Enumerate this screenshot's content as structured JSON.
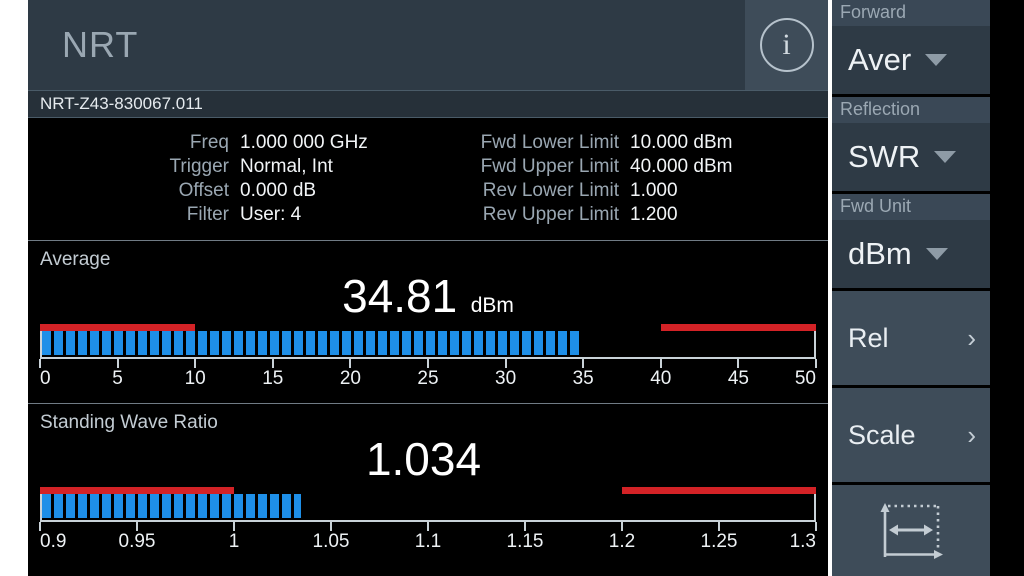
{
  "header": {
    "app_title": "NRT",
    "info_icon": "info-icon",
    "info_glyph": "i"
  },
  "device": {
    "id": "NRT-Z43-830067.011"
  },
  "parameters": {
    "left": [
      {
        "label": "Freq",
        "value": "1.000 000 GHz"
      },
      {
        "label": "Trigger",
        "value": "Normal, Int"
      },
      {
        "label": "Offset",
        "value": "0.000 dB"
      },
      {
        "label": "Filter",
        "value": "User: 4"
      }
    ],
    "right": [
      {
        "label": "Fwd Lower Limit",
        "value": "10.000 dBm"
      },
      {
        "label": "Fwd Upper Limit",
        "value": "40.000 dBm"
      },
      {
        "label": "Rev Lower Limit",
        "value": "1.000"
      },
      {
        "label": "Rev Upper Limit",
        "value": "1.200"
      }
    ]
  },
  "colors": {
    "bar_blue": "#1e8fe8",
    "limit_red": "#d32226",
    "panel_slate": "#2e3a45",
    "button_slate": "#3e4c59",
    "screen_black": "#000000"
  },
  "chart_data": [
    {
      "type": "bar",
      "title": "Average",
      "value": 34.81,
      "value_text": "34.81",
      "unit": "dBm",
      "xlim": [
        0,
        50
      ],
      "tick_labels": [
        "0",
        "5",
        "10",
        "15",
        "20",
        "25",
        "30",
        "35",
        "40",
        "45",
        "50"
      ],
      "ticks": [
        0,
        5,
        10,
        15,
        20,
        25,
        30,
        35,
        40,
        45,
        50
      ],
      "limit_zones": [
        {
          "name": "lower-limit-zone",
          "from": 0,
          "to": 10
        },
        {
          "name": "upper-limit-zone",
          "from": 40,
          "to": 50
        }
      ],
      "grid": false,
      "legend": "none"
    },
    {
      "type": "bar",
      "title": "Standing Wave Ratio",
      "value": 1.034,
      "value_text": "1.034",
      "unit": "",
      "xlim": [
        0.9,
        1.3
      ],
      "tick_labels": [
        "0.9",
        "0.95",
        "1",
        "1.05",
        "1.1",
        "1.15",
        "1.2",
        "1.25",
        "1.3"
      ],
      "ticks": [
        0.9,
        0.95,
        1,
        1.05,
        1.1,
        1.15,
        1.2,
        1.25,
        1.3
      ],
      "limit_zones": [
        {
          "name": "lower-limit-zone",
          "from": 0.9,
          "to": 1.0
        },
        {
          "name": "upper-limit-zone",
          "from": 1.2,
          "to": 1.3
        }
      ],
      "grid": false,
      "legend": "none"
    }
  ],
  "sidebar": {
    "dropdowns": [
      {
        "label": "Forward",
        "value": "Aver",
        "icon": "chevron-down-icon"
      },
      {
        "label": "Reflection",
        "value": "SWR",
        "icon": "chevron-down-icon"
      },
      {
        "label": "Fwd Unit",
        "value": "dBm",
        "icon": "chevron-down-icon"
      }
    ],
    "buttons": [
      {
        "label": "Rel",
        "icon": "chevron-right-icon",
        "chevron": "›"
      },
      {
        "label": "Scale",
        "icon": "chevron-right-icon",
        "chevron": "›"
      }
    ],
    "icon_button": {
      "icon": "autoscale-icon"
    }
  }
}
